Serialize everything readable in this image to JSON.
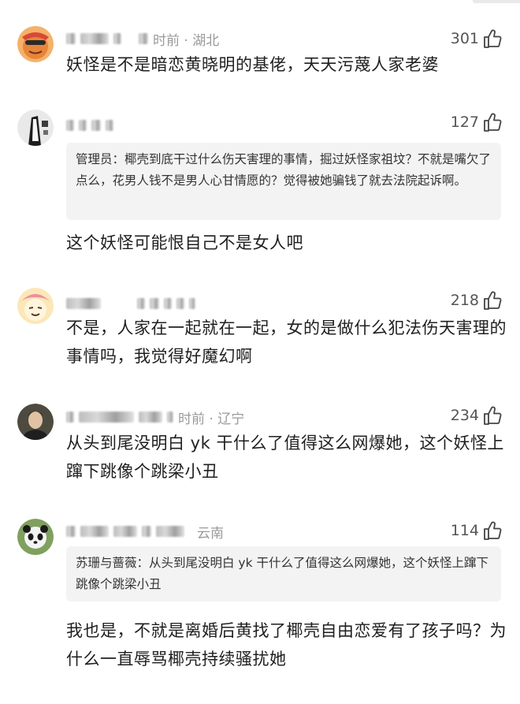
{
  "comments": [
    {
      "meta": "时前 · 湖北",
      "likes": "301",
      "body": "妖怪是不是暗恋黄晓明的基佬，天天污蔑人家老婆"
    },
    {
      "meta": "",
      "likes": "127",
      "quote": "管理员：椰壳到底干过什么伤天害理的事情，掘过妖怪家祖坟？不就是嘴欠了点么，花男人钱不是男人心甘情愿的？觉得被她骗钱了就去法院起诉啊。",
      "body": "这个妖怪可能恨自己不是女人吧"
    },
    {
      "meta": "",
      "likes": "218",
      "body": "不是，人家在一起就在一起，女的是做什么犯法伤天害理的事情吗，我觉得好魔幻啊"
    },
    {
      "meta": "时前 · 辽宁",
      "likes": "234",
      "body": "从头到尾没明白 yk 干什么了值得这么网爆她，这个妖怪上蹿下跳像个跳梁小丑"
    },
    {
      "meta": "云南",
      "likes": "114",
      "quote": "苏珊与蔷薇：从头到尾没明白 yk 干什么了值得这么网爆她，这个妖怪上蹿下跳像个跳梁小丑",
      "body": "我也是，不就是离婚后黄找了椰壳自由恋爱有了孩子吗？为什么一直辱骂椰壳持续骚扰她"
    }
  ],
  "icons": {
    "like": "thumbs-up-icon"
  }
}
